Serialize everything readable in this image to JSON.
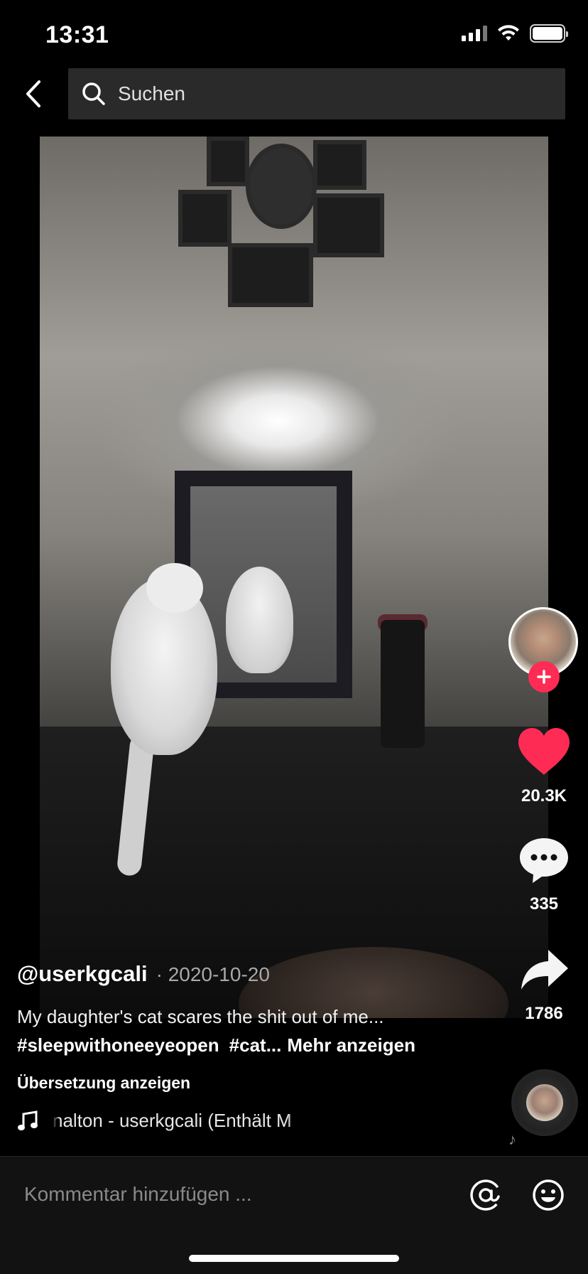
{
  "status_bar": {
    "time": "13:31"
  },
  "search": {
    "placeholder": "Suchen"
  },
  "video": {
    "author": "@userkgcali",
    "date": "· 2020-10-20",
    "description": "My daughter's cat scares the shit out of me...",
    "hashtags": [
      "#sleepwithoneeyeopen",
      "#cat..."
    ],
    "more_label": "Mehr anzeigen",
    "translate_label": "Übersetzung anzeigen",
    "music": "nalton - userkgcali (Enthält M"
  },
  "actions": {
    "likes": "20.3K",
    "comments": "335",
    "shares": "1786"
  },
  "comment_bar": {
    "placeholder": "Kommentar hinzufügen ..."
  },
  "colors": {
    "accent": "#fe2c55",
    "like": "#fe2c55",
    "background": "#000000"
  },
  "icons": [
    "back-arrow-icon",
    "search-icon",
    "plus-icon",
    "heart-icon",
    "comment-bubble-icon",
    "share-arrow-icon",
    "music-note-icon",
    "at-icon",
    "emoji-icon"
  ]
}
